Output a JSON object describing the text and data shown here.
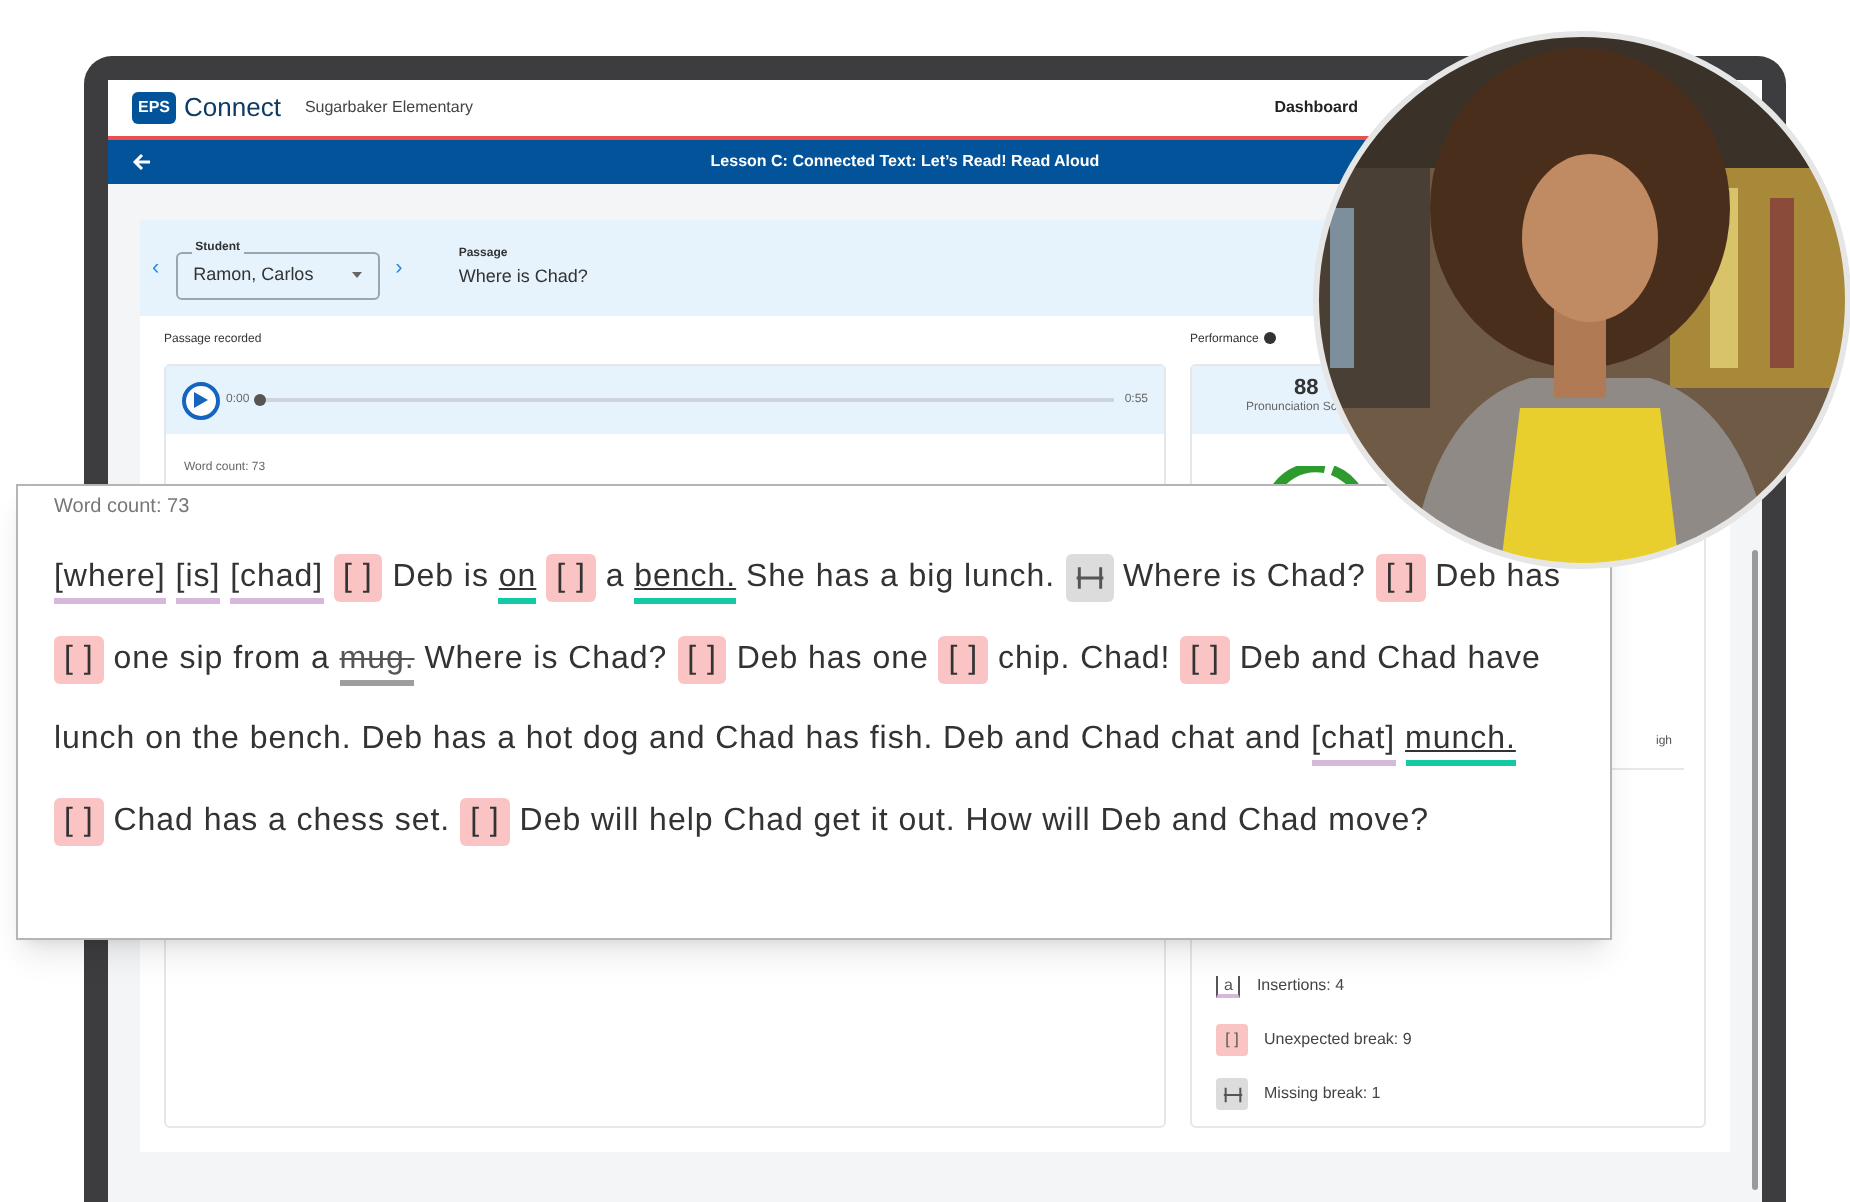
{
  "app": {
    "logo": "EPS",
    "name": "Connect",
    "school": "Sugarbaker Elementary",
    "nav": [
      "Dashboard"
    ]
  },
  "lesson_bar": {
    "title": "Lesson C: Connected Text: Let’s Read! Read Aloud"
  },
  "student": {
    "prev": "‹",
    "label": "Student",
    "value": "Ramon, Carlos",
    "next": "›"
  },
  "passage": {
    "label": "Passage",
    "title": "Where is Chad?"
  },
  "recording": {
    "label": "Passage recorded",
    "time_start": "0:00",
    "time_end": "0:55",
    "level": 0,
    "word_count": "Word count: 73"
  },
  "performance": {
    "label": "Performance",
    "score": "88",
    "score_label": "Pronunciation Sc",
    "cut_label": "igh",
    "legend": [
      {
        "kind": "insertion",
        "sample": "a",
        "label": "Insertions: 4"
      },
      {
        "kind": "break",
        "sample": "[ ]",
        "label": "Unexpected break: 9"
      },
      {
        "kind": "missing",
        "label": "Missing break: 1"
      }
    ]
  },
  "zoom_panel": {
    "word_count": "Word count: 73",
    "lines": [
      [
        {
          "kind": "insertion",
          "text": "[where]"
        },
        {
          "kind": "insertion",
          "text": "[is]"
        },
        {
          "kind": "insertion",
          "text": "[chad]"
        },
        {
          "kind": "break",
          "text": "[ ]"
        },
        {
          "kind": "text",
          "text": "Deb is"
        },
        {
          "kind": "flagged",
          "text": "on"
        },
        {
          "kind": "break",
          "text": "[ ]"
        },
        {
          "kind": "text",
          "text": "a"
        },
        {
          "kind": "flagged",
          "text": "bench."
        },
        {
          "kind": "text",
          "text": "She has a big lunch."
        },
        {
          "kind": "missing"
        },
        {
          "kind": "text",
          "text": "Where is Chad?"
        },
        {
          "kind": "break",
          "text": "[ ]"
        },
        {
          "kind": "text",
          "text": "Deb has"
        }
      ],
      [
        {
          "kind": "break",
          "text": "[ ]"
        },
        {
          "kind": "text",
          "text": "one sip from a"
        },
        {
          "kind": "omission",
          "text": "mug."
        },
        {
          "kind": "text",
          "text": "Where is Chad?"
        },
        {
          "kind": "break",
          "text": "[ ]"
        },
        {
          "kind": "text",
          "text": "Deb has one"
        },
        {
          "kind": "break",
          "text": "[ ]"
        },
        {
          "kind": "text",
          "text": "chip. Chad!"
        },
        {
          "kind": "break",
          "text": "[ ]"
        },
        {
          "kind": "text",
          "text": "Deb and Chad have"
        }
      ],
      [
        {
          "kind": "text",
          "text": "lunch on the bench. Deb has a hot dog and Chad has fish. Deb and Chad chat and"
        },
        {
          "kind": "insertion",
          "text": "[chat]"
        },
        {
          "kind": "flagged",
          "text": "munch."
        }
      ],
      [
        {
          "kind": "break",
          "text": "[ ]"
        },
        {
          "kind": "text",
          "text": "Chad has a chess set."
        },
        {
          "kind": "break",
          "text": "[ ]"
        },
        {
          "kind": "text",
          "text": "Deb will help Chad get it out. How will Deb and Chad move?"
        }
      ]
    ]
  }
}
